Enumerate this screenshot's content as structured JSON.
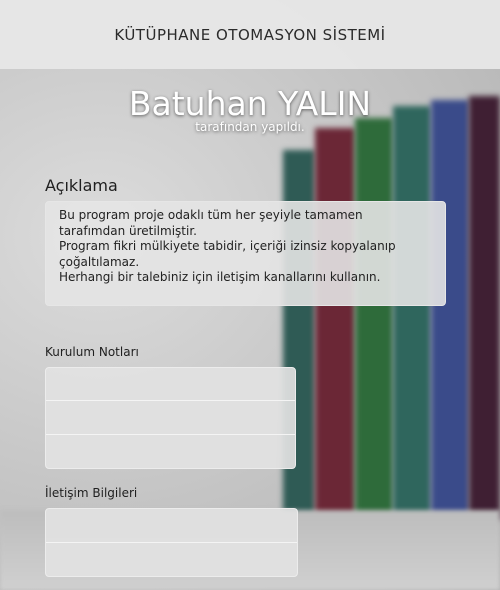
{
  "header": {
    "title": "KÜTÜPHANE OTOMASYON SİSTEMİ"
  },
  "author": {
    "name": "Batuhan YALIN",
    "subtitle": "tarafından yapıldı."
  },
  "description": {
    "label": "Açıklama",
    "lines": [
      "Bu program proje odaklı tüm her şeyiyle tamamen",
      "tarafımdan üretilmiştir.",
      "Program fikri mülkiyete tabidir, içeriği izinsiz kopyalanıp",
      "çoğaltılamaz.",
      "Herhangi bir talebiniz için iletişim kanallarını kullanın."
    ]
  },
  "setup_notes": {
    "label": "Kurulum Notları",
    "fields": [
      "",
      "",
      ""
    ]
  },
  "contact": {
    "label": "İletişim Bilgileri",
    "fields": [
      "",
      ""
    ]
  },
  "colors": {
    "header_bg": "#e8e8e8",
    "text": "#2b2b2b",
    "author_text": "#ffffff"
  }
}
